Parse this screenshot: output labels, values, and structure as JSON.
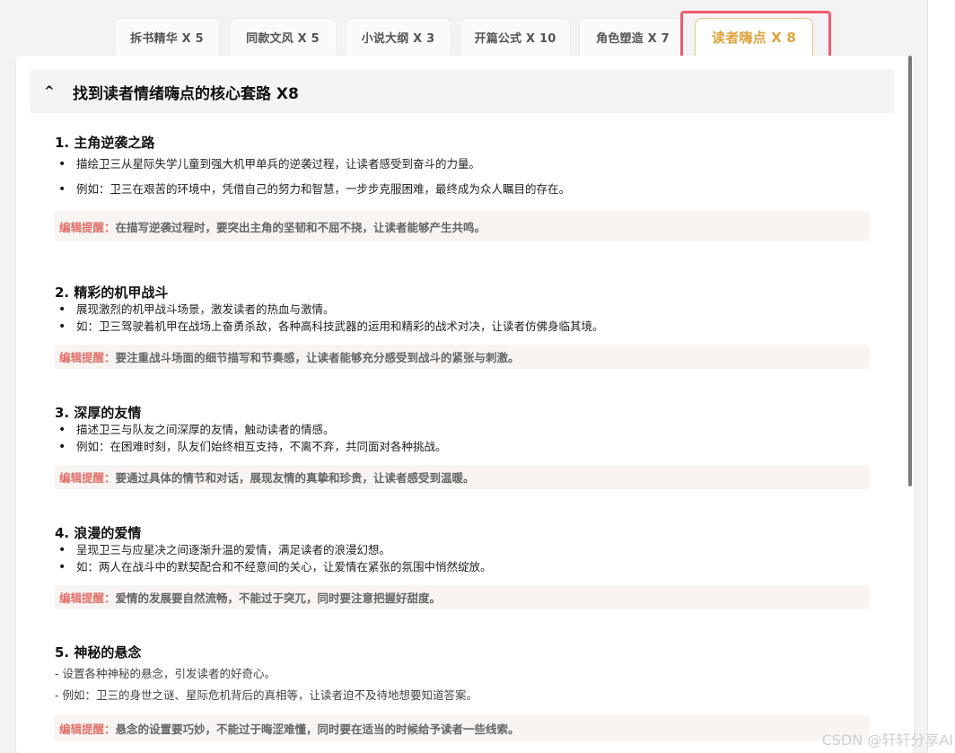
{
  "tabs": [
    {
      "label": "拆书精华 X 5"
    },
    {
      "label": "同款文风 X 5"
    },
    {
      "label": "小说大纲 X 3"
    },
    {
      "label": "开篇公式 X 10"
    },
    {
      "label": "角色塑造 X 7"
    },
    {
      "label": "读者嗨点 X 8",
      "active": true
    }
  ],
  "section": {
    "caret": "^",
    "title": "找到读者情绪嗨点的核心套路 X8"
  },
  "tip_label": "编辑提醒：",
  "items": [
    {
      "title": "1. 主角逆袭之路",
      "lines": [
        "描绘卫三从星际失学儿童到强大机甲单兵的逆袭过程，让读者感受到奋斗的力量。",
        "例如：卫三在艰苦的环境中，凭借自己的努力和智慧，一步步克服困难，最终成为众人瞩目的存在。"
      ],
      "tip": "在描写逆袭过程时，要突出主角的坚韧和不屈不挠，让读者能够产生共鸣。"
    },
    {
      "title": "2. 精彩的机甲战斗",
      "lines": [
        "展现激烈的机甲战斗场景，激发读者的热血与激情。",
        "如：卫三驾驶着机甲在战场上奋勇杀敌，各种高科技武器的运用和精彩的战术对决，让读者仿佛身临其境。"
      ],
      "tip": "要注重战斗场面的细节描写和节奏感，让读者能够充分感受到战斗的紧张与刺激。"
    },
    {
      "title": "3. 深厚的友情",
      "lines": [
        "描述卫三与队友之间深厚的友情，触动读者的情感。",
        "例如：在困难时刻，队友们始终相互支持，不离不弃，共同面对各种挑战。"
      ],
      "tip": "要通过具体的情节和对话，展现友情的真挚和珍贵，让读者感受到温暖。"
    },
    {
      "title": "4. 浪漫的爱情",
      "lines": [
        "呈现卫三与应星决之间逐渐升温的爱情，满足读者的浪漫幻想。",
        "如：两人在战斗中的默契配合和不经意间的关心，让爱情在紧张的氛围中悄然绽放。"
      ],
      "tip": "爱情的发展要自然流畅，不能过于突兀，同时要注意把握好甜度。"
    },
    {
      "title": "5. 神秘的悬念",
      "lines": [
        "- 设置各种神秘的悬念，引发读者的好奇心。",
        "- 例如：卫三的身世之谜、星际危机背后的真相等，让读者迫不及待地想要知道答案。"
      ],
      "tip": "悬念的设置要巧妙，不能过于晦涩难懂，同时要在适当的时候给予读者一些线索。"
    }
  ],
  "watermark": "CSDN @轩轩分享AI",
  "colors": {
    "active_tab_text": "#e0a23b",
    "highlight_box": "#ef5b6e",
    "tip_label": "#e2706a",
    "tip_bg": "#f7f4f2"
  }
}
